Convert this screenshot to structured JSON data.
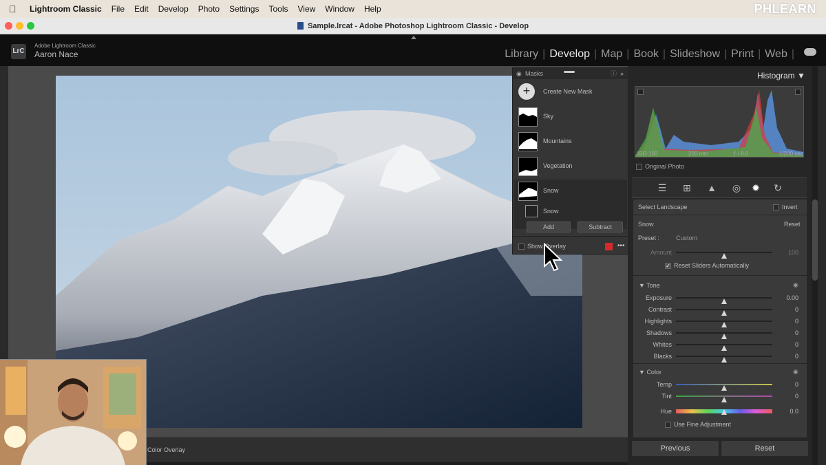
{
  "menubar": {
    "items": [
      "Lightroom Classic",
      "File",
      "Edit",
      "Develop",
      "Photo",
      "Settings",
      "Tools",
      "View",
      "Window",
      "Help"
    ],
    "watermark": "PHLEARN"
  },
  "window": {
    "title": "Sample.lrcat - Adobe Photoshop Lightroom Classic - Develop"
  },
  "identity": {
    "product": "Adobe Lightroom Classic",
    "user": "Aaron Nace",
    "logo": "LrC"
  },
  "modules": [
    {
      "label": "Library",
      "active": false
    },
    {
      "label": "Develop",
      "active": true
    },
    {
      "label": "Map",
      "active": false
    },
    {
      "label": "Book",
      "active": false
    },
    {
      "label": "Slideshow",
      "active": false
    },
    {
      "label": "Print",
      "active": false
    },
    {
      "label": "Web",
      "active": false
    }
  ],
  "masks": {
    "title": "Masks",
    "create": "Create New Mask",
    "items": [
      "Sky",
      "Mountains",
      "Vegetation",
      "Snow"
    ],
    "sub_item": "Snow",
    "add": "Add",
    "subtract": "Subtract",
    "show_overlay": "Show Overlay",
    "overlay_color": "#d42a2a"
  },
  "histogram": {
    "title": "Histogram",
    "iso": "ISO 100",
    "focal": "200 mm",
    "aperture": "ƒ / 8.0",
    "shutter": "1/200 sec",
    "original_photo": "Original Photo"
  },
  "adjust": {
    "select": "Select Landscape",
    "invert": "Invert",
    "mask_name": "Snow",
    "reset": "Reset",
    "preset_label": "Preset :",
    "preset_value": "Custom",
    "amount_label": "Amount",
    "amount_value": "100",
    "amount_level": 0.5,
    "reset_sliders": "Reset Sliders Automatically",
    "tone_header": "Tone",
    "tone": [
      {
        "label": "Exposure",
        "value": "0.00",
        "level": 0.5
      },
      {
        "label": "Contrast",
        "value": "0",
        "level": 0.5
      },
      {
        "label": "Highlights",
        "value": "0",
        "level": 0.5
      },
      {
        "label": "Shadows",
        "value": "0",
        "level": 0.5
      },
      {
        "label": "Whites",
        "value": "0",
        "level": 0.5
      },
      {
        "label": "Blacks",
        "value": "0",
        "level": 0.5
      }
    ],
    "color_header": "Color",
    "color": [
      {
        "label": "Temp",
        "value": "0",
        "level": 0.5
      },
      {
        "label": "Tint",
        "value": "0",
        "level": 0.5
      },
      {
        "label": "Hue",
        "value": "0.0",
        "level": 0.5
      }
    ],
    "fine": "Use Fine Adjustment"
  },
  "bottom": {
    "overlay_select": "Color Overlay"
  },
  "buttons": {
    "previous": "Previous",
    "reset": "Reset"
  }
}
